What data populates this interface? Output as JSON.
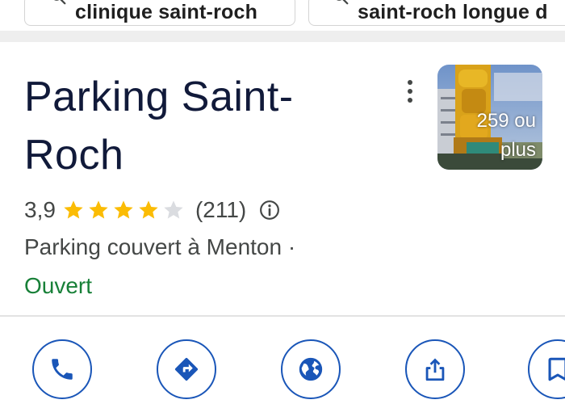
{
  "suggestions": [
    {
      "label": "clinique saint-roch",
      "icon": "search-icon"
    },
    {
      "label": "saint-roch longue d",
      "icon": "search-icon"
    }
  ],
  "place": {
    "title": "Parking Saint-Roch",
    "rating": "3,9",
    "rating_stars": 4,
    "rating_max": 5,
    "review_count": "(211)",
    "category": "Parking couvert à Menton ·",
    "status": "Ouvert",
    "photo_caption": "259 ou plus"
  },
  "actions": [
    {
      "name": "call",
      "icon": "phone-icon"
    },
    {
      "name": "directions",
      "icon": "directions-icon"
    },
    {
      "name": "website",
      "icon": "globe-icon"
    },
    {
      "name": "share",
      "icon": "share-icon"
    },
    {
      "name": "save",
      "icon": "bookmark-icon"
    }
  ],
  "colors": {
    "title": "#111a3a",
    "star": "#fbbc04",
    "star_empty": "#dadce0",
    "open_status": "#188038",
    "action_accent": "#1a56b8"
  }
}
